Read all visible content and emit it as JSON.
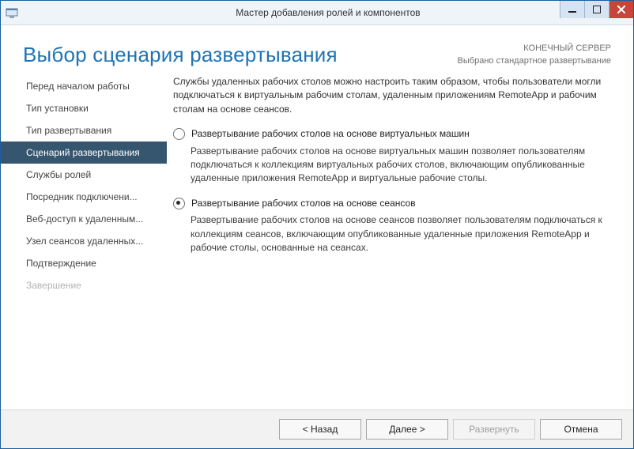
{
  "titlebar": {
    "title": "Мастер добавления ролей и компонентов"
  },
  "header": {
    "title": "Выбор сценария развертывания",
    "subtitle_line1": "КОНЕЧНЫЙ СЕРВЕР",
    "subtitle_line2": "Выбрано стандартное развертывание"
  },
  "nav": {
    "items": [
      {
        "label": "Перед началом работы"
      },
      {
        "label": "Тип установки"
      },
      {
        "label": "Тип развертывания"
      },
      {
        "label": "Сценарий развертывания"
      },
      {
        "label": "Службы ролей"
      },
      {
        "label": "Посредник подключени..."
      },
      {
        "label": "Веб-доступ к удаленным..."
      },
      {
        "label": "Узел сеансов удаленных..."
      },
      {
        "label": "Подтверждение"
      },
      {
        "label": "Завершение"
      }
    ]
  },
  "content": {
    "intro": "Службы удаленных рабочих столов можно настроить таким образом, чтобы пользователи могли подключаться к виртуальным рабочим столам, удаленным приложениям RemoteApp и рабочим столам на основе сеансов.",
    "options": [
      {
        "title": "Развертывание рабочих столов на основе виртуальных машин",
        "desc": "Развертывание рабочих столов на основе виртуальных машин позволяет пользователям подключаться к коллекциям виртуальных рабочих столов, включающим опубликованные удаленные приложения RemoteApp и виртуальные рабочие столы."
      },
      {
        "title": "Развертывание рабочих столов на основе сеансов",
        "desc": "Развертывание рабочих столов на основе сеансов позволяет пользователям подключаться к коллекциям сеансов, включающим опубликованные удаленные приложения RemoteApp и рабочие столы, основанные на сеансах."
      }
    ]
  },
  "footer": {
    "back": "< Назад",
    "next": "Далее >",
    "deploy": "Развернуть",
    "cancel": "Отмена"
  }
}
